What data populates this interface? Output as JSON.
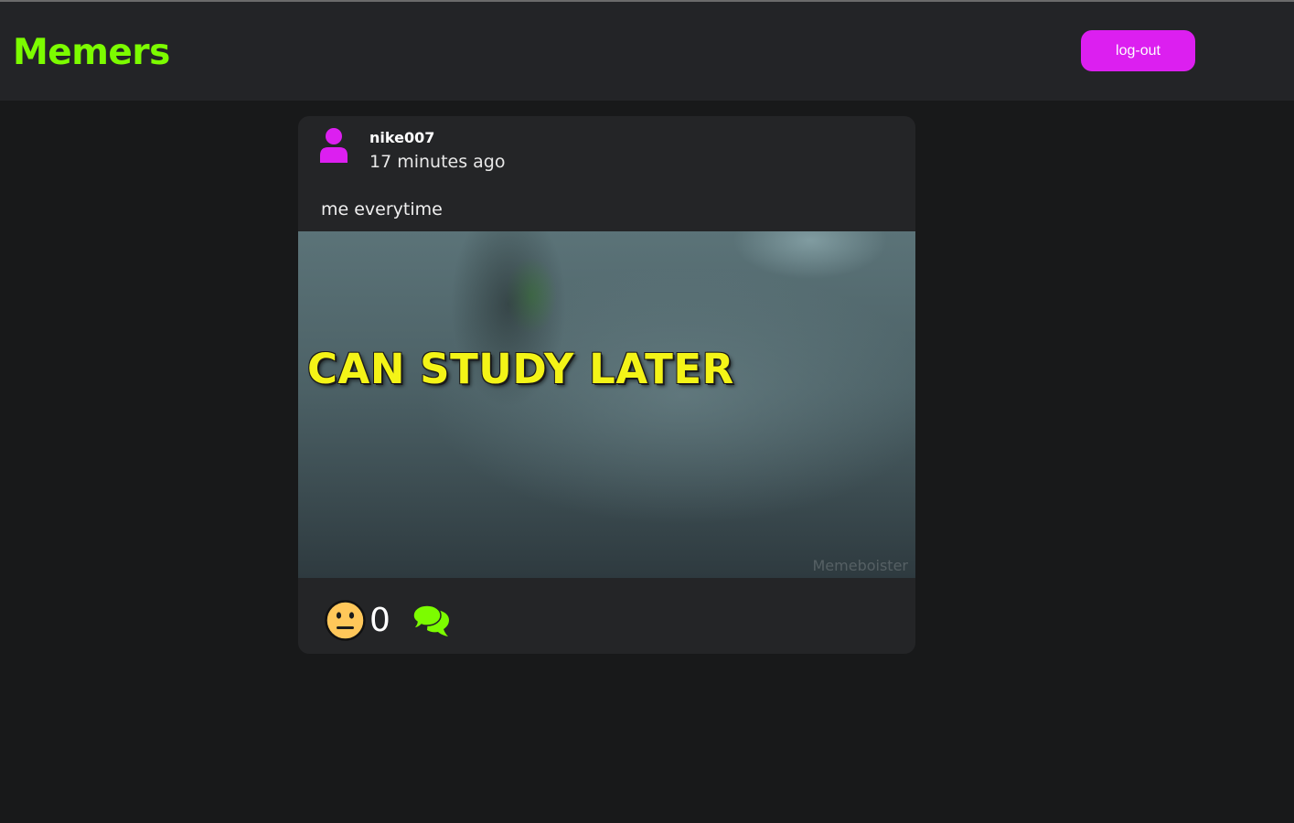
{
  "header": {
    "brand": "Memers",
    "brand_color": "#7cfc00",
    "logout_label": "log-out",
    "logout_color": "#dc1ff0"
  },
  "post": {
    "username": "nike007",
    "timestamp": "17 minutes ago",
    "caption": "me everytime",
    "image": {
      "overlay_text": "CAN STUDY LATER",
      "overlay_color": "#f4f417",
      "watermark": "Memeboister"
    },
    "reaction_icon": "neutral-face-icon",
    "reaction_count": "0",
    "comment_icon": "comments-icon",
    "avatar_icon": "user-icon",
    "avatar_color": "#dc1ff0",
    "comment_color": "#7cfc00"
  }
}
